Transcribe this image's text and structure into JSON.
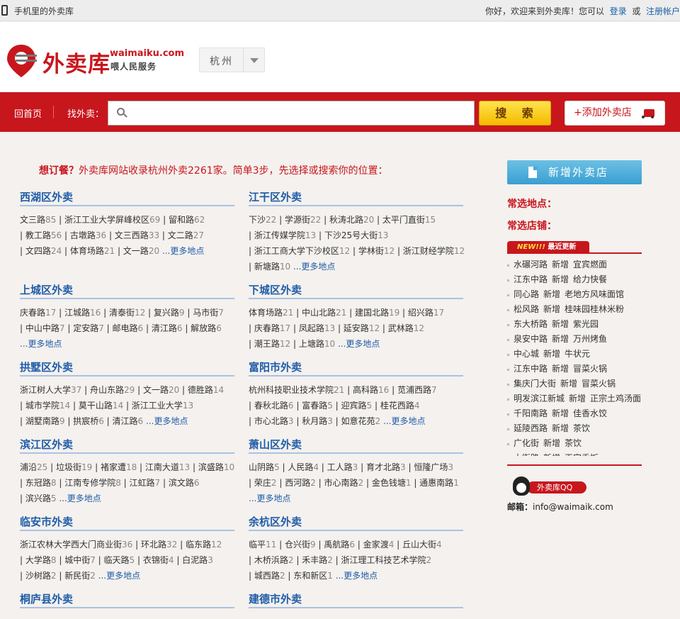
{
  "topbar": {
    "mobile": "手机里的外卖库",
    "welcome": "你好，欢迎来到外卖库！您可以",
    "login": "登录",
    "or": "或",
    "register": "注册帐户"
  },
  "header": {
    "brand_cn": "外卖库",
    "brand_en": "waimaiku.com",
    "slogan": "喂人民服务",
    "city": "杭州"
  },
  "nav": {
    "home": "回首页",
    "find": "找外卖：",
    "search_value": "",
    "search_button": "搜 索",
    "add_shop": "+添加外卖店"
  },
  "intro": {
    "q": "想订餐？",
    "text": "外卖库网站收录杭州外卖2261家。简单3步，先选择或搜索你的位置："
  },
  "districts": [
    {
      "title": "西湖区外卖",
      "lines": [
        [
          "文三路",
          "85",
          "浙江工业大学屏峰校区",
          "69",
          "留和路",
          "62"
        ],
        [
          "教工路",
          "56",
          "古墩路",
          "36",
          "文三西路",
          "33",
          "文二路",
          "27"
        ],
        [
          "文四路",
          "24",
          "体育场路",
          "21",
          "文一路",
          "20"
        ]
      ],
      "more": "...更多地点",
      "more_line": 2
    },
    {
      "title": "江干区外卖",
      "lines": [
        [
          "下沙",
          "22",
          "学源街",
          "22",
          "秋涛北路",
          "20",
          "太平门直街",
          "15"
        ],
        [
          "浙江传媒学院",
          "13",
          "下沙25号大街",
          "13"
        ],
        [
          "浙江工商大学下沙校区",
          "12",
          "学林街",
          "12",
          "浙江财经学院",
          "12"
        ],
        [
          "新塘路",
          "10"
        ]
      ],
      "more": "...更多地点",
      "more_line": 3
    },
    {
      "title": "上城区外卖",
      "lines": [
        [
          "庆春路",
          "17",
          "江城路",
          "16",
          "清泰街",
          "12",
          "复兴路",
          "9",
          "马市街",
          "7"
        ],
        [
          "中山中路",
          "7",
          "定安路",
          "7",
          "邮电路",
          "6",
          "清江路",
          "6",
          "解放路",
          "6"
        ]
      ],
      "more": "...更多地点",
      "more_line": 2
    },
    {
      "title": "下城区外卖",
      "lines": [
        [
          "体育场路",
          "21",
          "中山北路",
          "21",
          "建国北路",
          "19",
          "绍兴路",
          "17"
        ],
        [
          "庆春路",
          "17",
          "凤起路",
          "13",
          "延安路",
          "12",
          "武林路",
          "12"
        ],
        [
          "潮王路",
          "12",
          "上塘路",
          "10"
        ]
      ],
      "more": "...更多地点",
      "more_line": 2
    },
    {
      "title": "拱墅区外卖",
      "lines": [
        [
          "浙江树人大学",
          "37",
          "舟山东路",
          "29",
          "文一路",
          "20",
          "德胜路",
          "14"
        ],
        [
          "城市学院",
          "14",
          "莫干山路",
          "14",
          "浙江工业大学",
          "13"
        ],
        [
          "湖墅南路",
          "9",
          "拱宸桥",
          "6",
          "清江路",
          "6"
        ]
      ],
      "more": "...更多地点",
      "more_line": 2
    },
    {
      "title": "富阳市外卖",
      "lines": [
        [
          "杭州科技职业技术学院",
          "21",
          "高科路",
          "16",
          "苋浦西路",
          "7"
        ],
        [
          "春秋北路",
          "6",
          "富春路",
          "5",
          "迎宾路",
          "5",
          "桂花西路",
          "4"
        ],
        [
          "市心北路",
          "3",
          "秋月路",
          "3",
          "如意花苑",
          "2"
        ]
      ],
      "more": "...更多地点",
      "more_line": 2
    },
    {
      "title": "滨江区外卖",
      "lines": [
        [
          "浦沿",
          "25",
          "垃圾街",
          "19",
          "褚家遭",
          "18",
          "江南大道",
          "13",
          "滨盛路",
          "10"
        ],
        [
          "东冠路",
          "8",
          "江南专修学院",
          "8",
          "江虹路",
          "7",
          "滨文路",
          "6"
        ],
        [
          "滨兴路",
          "5"
        ]
      ],
      "more": "...更多地点",
      "more_line": 2
    },
    {
      "title": "萧山区外卖",
      "lines": [
        [
          "山阴路",
          "5",
          "人民路",
          "4",
          "工人路",
          "3",
          "育才北路",
          "3",
          "恒隆广场",
          "3"
        ],
        [
          "荣庄",
          "2",
          "西河路",
          "2",
          "市心南路",
          "2",
          "金色钱塘",
          "1",
          "通惠南路",
          "1"
        ]
      ],
      "more": "...更多地点",
      "more_line": 2
    },
    {
      "title": "临安市外卖",
      "lines": [
        [
          "浙江农林大学西大门商业街",
          "36",
          "环北路",
          "32",
          "临东路",
          "12"
        ],
        [
          "大学路",
          "8",
          "城中街",
          "7",
          "临天路",
          "5",
          "衣锦街",
          "4",
          "白泥路",
          "3"
        ],
        [
          "沙树路",
          "2",
          "新民街",
          "2"
        ]
      ],
      "more": "...更多地点",
      "more_line": 2
    },
    {
      "title": "余杭区外卖",
      "lines": [
        [
          "临平",
          "11",
          "仓兴街",
          "9",
          "禹航路",
          "6",
          "金家渡",
          "4",
          "丘山大街",
          "4"
        ],
        [
          "木桥浜路",
          "2",
          "禾丰路",
          "2",
          "浙江理工科技艺术学院",
          "2"
        ],
        [
          "城西路",
          "2",
          "东和新区",
          "1"
        ]
      ],
      "more": "...更多地点",
      "more_line": 2
    },
    {
      "title": "桐庐县外卖",
      "lines": [],
      "more": "",
      "more_line": -1
    },
    {
      "title": "建德市外卖",
      "lines": [],
      "more": "",
      "more_line": -1
    }
  ],
  "sidebar": {
    "new_shop": "新增外卖店",
    "common_places": "常选地点：",
    "common_shops": "常选店铺：",
    "new_badge": "NEW!!!",
    "recent": "最近更新",
    "verb": "新增",
    "updates": [
      [
        "水碾河路",
        "宜宾燃面"
      ],
      [
        "江东中路",
        "给力快餐"
      ],
      [
        "同心路",
        "老地方风味面馆"
      ],
      [
        "松风路",
        "桂味园桂林米粉"
      ],
      [
        "东大桥路",
        "紫光园"
      ],
      [
        "泉安中路",
        "万州烤鱼"
      ],
      [
        "中心城",
        "牛状元"
      ],
      [
        "江东中路",
        "冒菜火锅"
      ],
      [
        "集庆门大街",
        "冒菜火锅"
      ],
      [
        "明发滨江新城",
        "正宗土鸡汤面"
      ],
      [
        "千阳南路",
        "佳香水饺"
      ],
      [
        "延陵西路",
        "茶饮"
      ],
      [
        "广化街",
        "茶饮"
      ],
      [
        "大街路",
        "王家香饭"
      ]
    ],
    "qq_label": "外卖库QQ",
    "mail_label": "邮箱：",
    "mail": "info@waimaik.com"
  },
  "colors": {
    "brand_red": "#c8161d",
    "link_blue": "#1f5ca8",
    "search_yellow": "#f5ba00",
    "sidebar_blue": "#3a9fd1"
  }
}
